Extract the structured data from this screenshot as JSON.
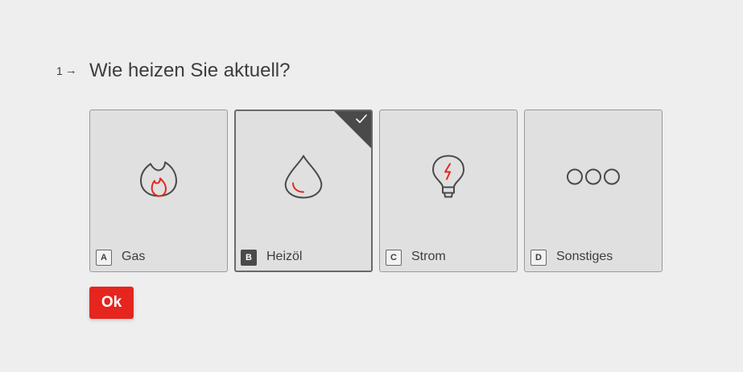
{
  "question": {
    "number": "1",
    "arrow": "→",
    "title": "Wie heizen Sie aktuell?"
  },
  "choices": [
    {
      "key": "A",
      "label": "Gas",
      "icon": "flame-icon",
      "selected": false
    },
    {
      "key": "B",
      "label": "Heizöl",
      "icon": "oil-drop-icon",
      "selected": true
    },
    {
      "key": "C",
      "label": "Strom",
      "icon": "lightbulb-icon",
      "selected": false
    },
    {
      "key": "D",
      "label": "Sonstiges",
      "icon": "three-circles-icon",
      "selected": false
    }
  ],
  "ok_button": {
    "label": "Ok"
  },
  "colors": {
    "accent": "#e6251f",
    "background": "#eeeeee",
    "card": "#e0e0e0",
    "selected_dark": "#4a4a4a"
  }
}
